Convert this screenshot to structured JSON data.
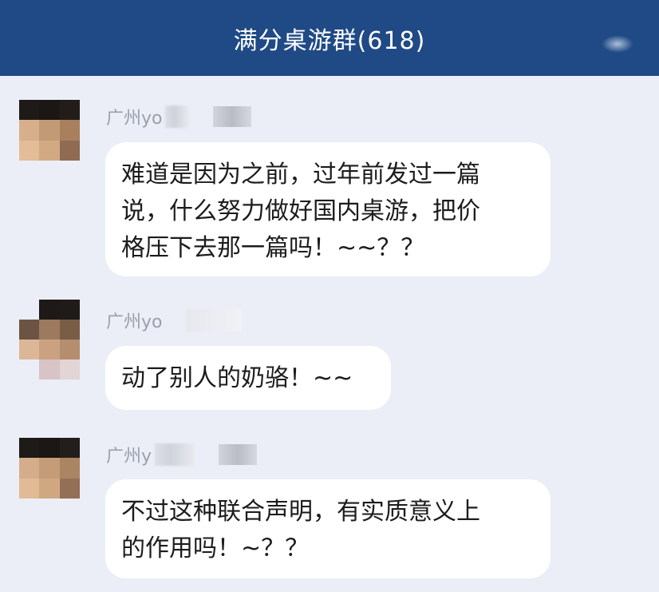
{
  "header": {
    "title": "满分桌游群(618)"
  },
  "messages": [
    {
      "sender": "广州yo",
      "lines": [
        "难道是因为之前，过年前发过一篇",
        "说，什么努力做好国内桌游，把价",
        "格压下去那一篇吗！~~？？"
      ]
    },
    {
      "sender": "广州yo",
      "lines": [
        "动了别人的奶骆！~~"
      ]
    },
    {
      "sender": "广州y",
      "lines": [
        "不过这种联合声明，有实质意义上",
        "的作用吗！~？？"
      ]
    }
  ],
  "colors": {
    "header_bg": "#1f4a85",
    "chat_bg": "#ebeef6",
    "bubble_bg": "#ffffff"
  }
}
